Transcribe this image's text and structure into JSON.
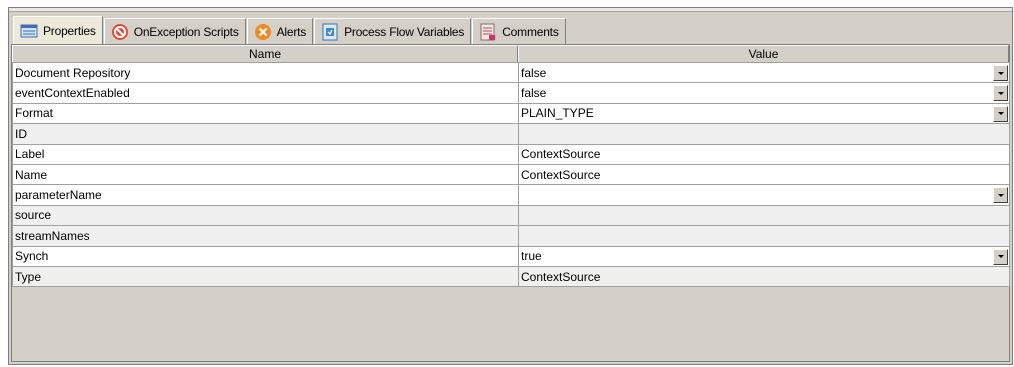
{
  "tabs": [
    {
      "label": "Properties",
      "icon": "properties-icon",
      "active": true
    },
    {
      "label": "OnException Scripts",
      "icon": "no-entry-icon"
    },
    {
      "label": "Alerts",
      "icon": "alert-x-icon"
    },
    {
      "label": "Process Flow Variables",
      "icon": "variables-icon"
    },
    {
      "label": "Comments",
      "icon": "comments-icon"
    }
  ],
  "table": {
    "columns": [
      "Name",
      "Value"
    ],
    "rows": [
      {
        "name": "Document Repository",
        "value": "false",
        "dropdown": true,
        "editable": true
      },
      {
        "name": "eventContextEnabled",
        "value": "false",
        "dropdown": true,
        "editable": true
      },
      {
        "name": "Format",
        "value": "PLAIN_TYPE",
        "dropdown": true,
        "editable": true
      },
      {
        "name": "ID",
        "value": "",
        "dropdown": false,
        "editable": false
      },
      {
        "name": "Label",
        "value": "ContextSource",
        "dropdown": false,
        "editable": true
      },
      {
        "name": "Name",
        "value": "ContextSource",
        "dropdown": false,
        "editable": true
      },
      {
        "name": "parameterName",
        "value": "",
        "dropdown": true,
        "editable": true
      },
      {
        "name": "source",
        "value": "",
        "dropdown": false,
        "editable": false
      },
      {
        "name": "streamNames",
        "value": "",
        "dropdown": false,
        "editable": false
      },
      {
        "name": "Synch",
        "value": "true",
        "dropdown": true,
        "editable": true
      },
      {
        "name": "Type",
        "value": "ContextSource",
        "dropdown": false,
        "editable": false
      }
    ]
  }
}
